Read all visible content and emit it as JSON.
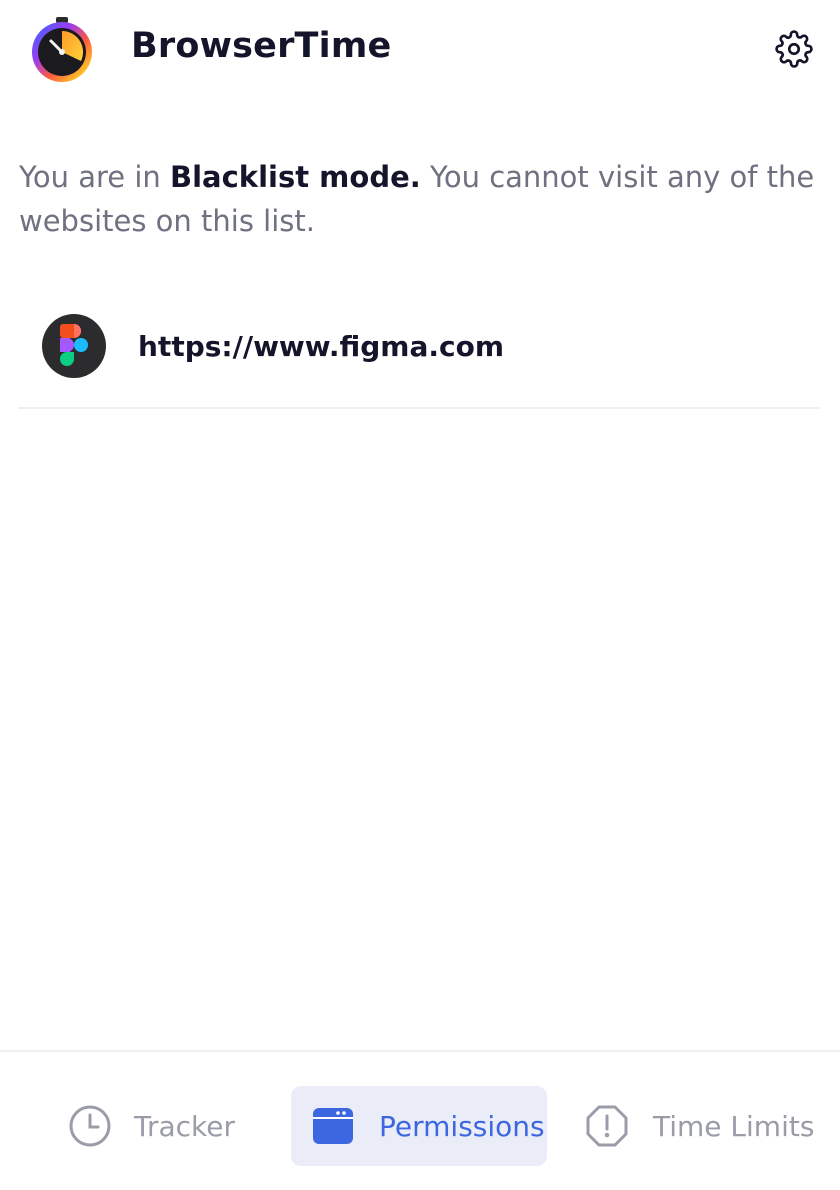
{
  "header": {
    "title": "BrowserTime",
    "logo_icon": "stopwatch-logo-icon",
    "settings_icon": "gear-icon"
  },
  "mode_message": {
    "prefix": "You are in ",
    "mode": "Blacklist mode.",
    "suffix": " You cannot visit any of the websites on this list."
  },
  "sites": [
    {
      "url": "https://www.figma.com",
      "icon": "figma-icon"
    }
  ],
  "nav": {
    "items": [
      {
        "label": "Tracker",
        "icon": "clock-icon",
        "active": false
      },
      {
        "label": "Permissions",
        "icon": "browser-window-icon",
        "active": true
      },
      {
        "label": "Time Limits",
        "icon": "alert-octagon-icon",
        "active": false
      }
    ]
  },
  "colors": {
    "accent": "#3d67e0",
    "active_bg": "#eaedf8",
    "text_dark": "#14152a",
    "text_muted": "#6f7180",
    "nav_inactive": "#9a9ca8"
  }
}
